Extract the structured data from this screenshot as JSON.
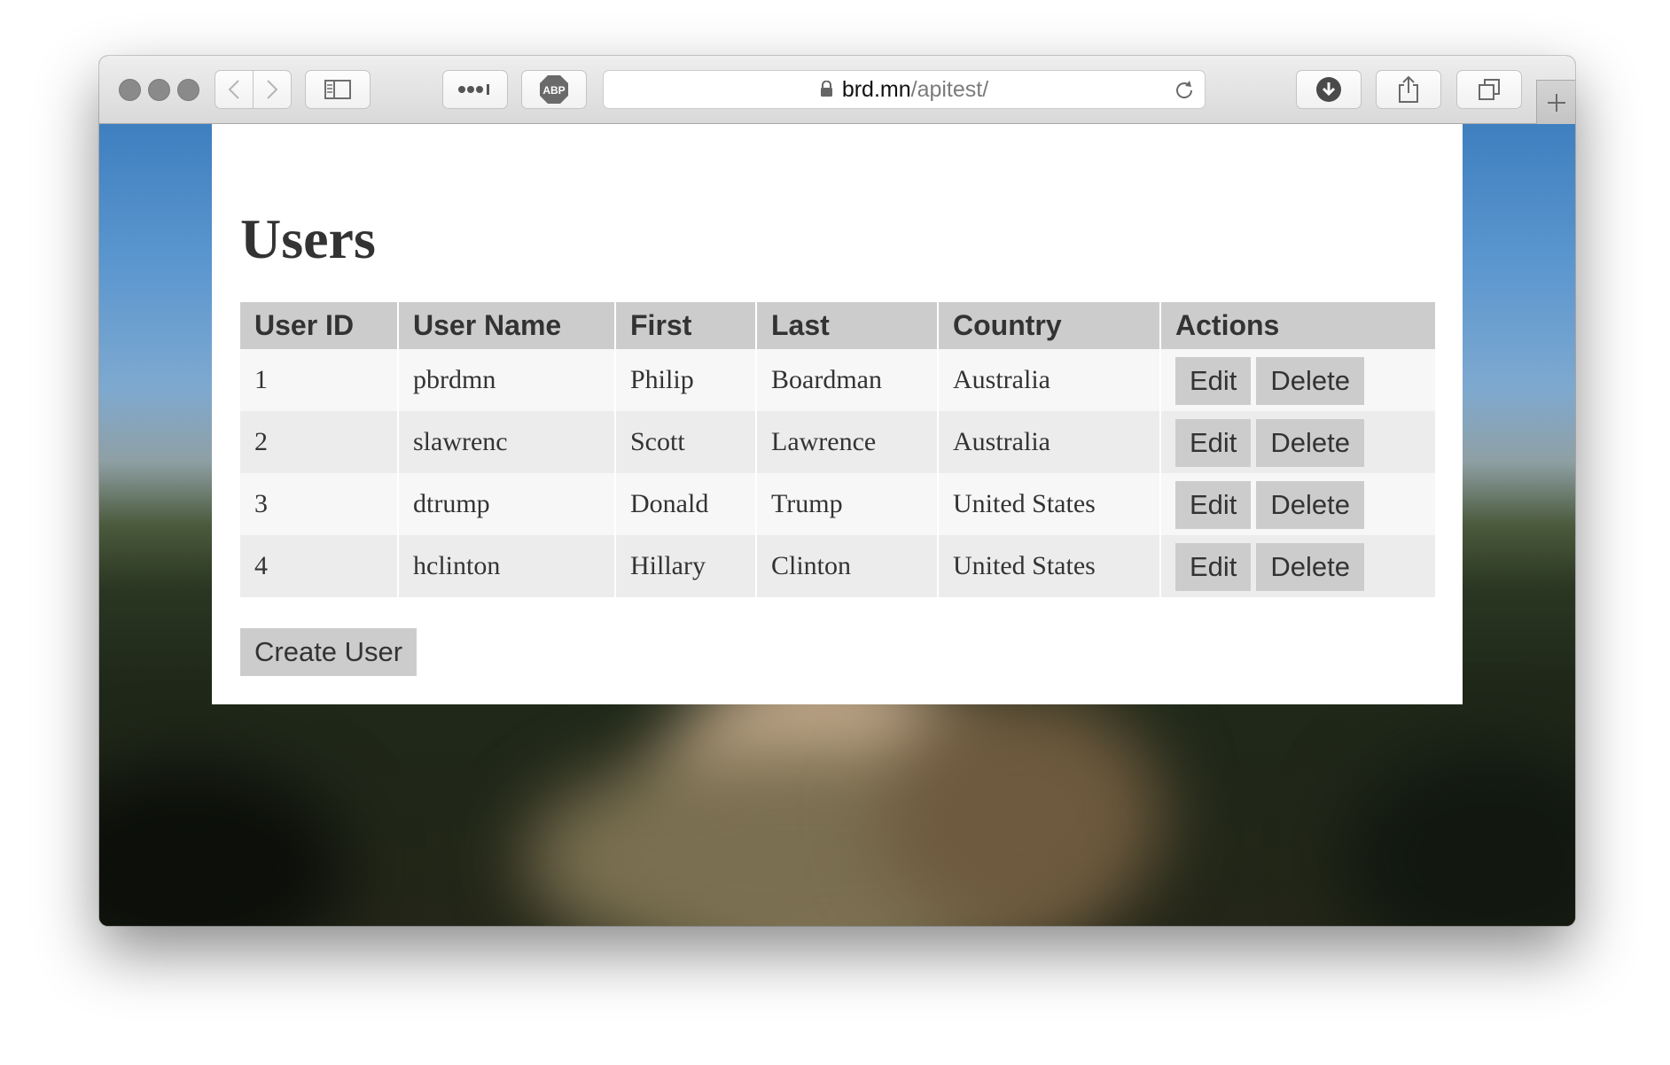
{
  "browser": {
    "url_domain": "brd.mn",
    "url_path": "/apitest/"
  },
  "page": {
    "title": "Users",
    "table": {
      "columns": [
        "User ID",
        "User Name",
        "First",
        "Last",
        "Country",
        "Actions"
      ],
      "rows": [
        {
          "id": "1",
          "username": "pbrdmn",
          "first": "Philip",
          "last": "Boardman",
          "country": "Australia"
        },
        {
          "id": "2",
          "username": "slawrenc",
          "first": "Scott",
          "last": "Lawrence",
          "country": "Australia"
        },
        {
          "id": "3",
          "username": "dtrump",
          "first": "Donald",
          "last": "Trump",
          "country": "United States"
        },
        {
          "id": "4",
          "username": "hclinton",
          "first": "Hillary",
          "last": "Clinton",
          "country": "United States"
        }
      ],
      "edit_label": "Edit",
      "delete_label": "Delete"
    },
    "create_button_label": "Create User"
  }
}
